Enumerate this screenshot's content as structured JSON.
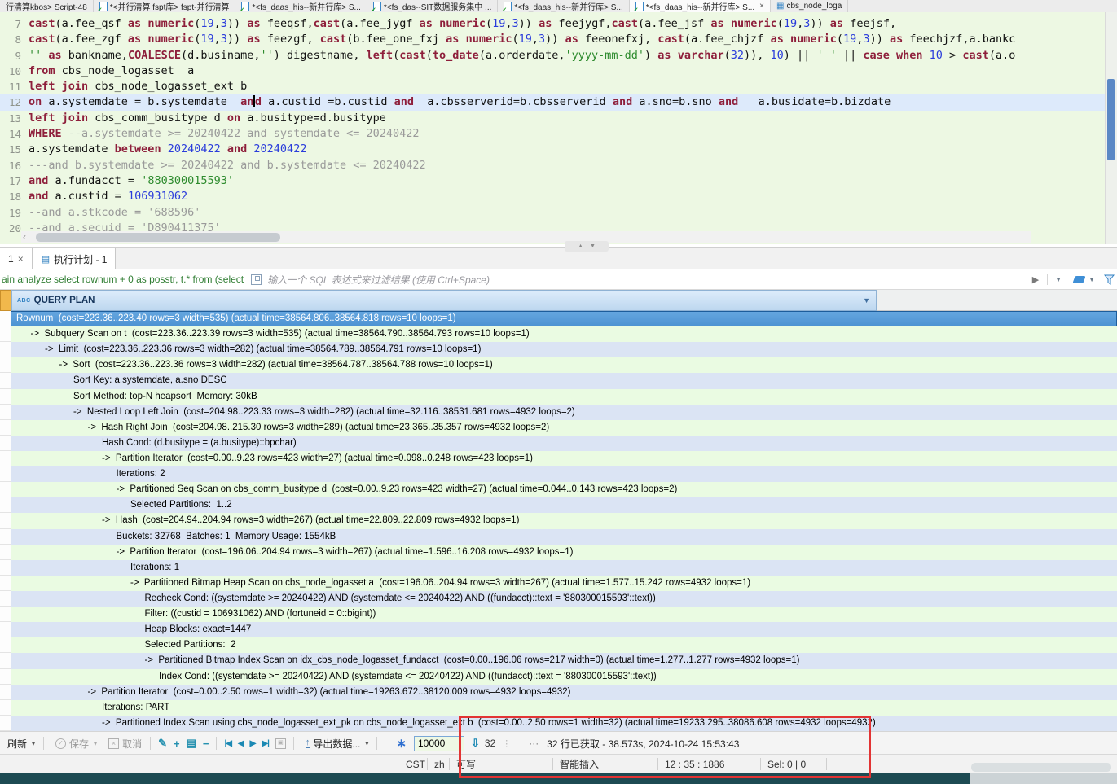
{
  "editor_tabs": [
    {
      "label": "行清算kbos> Script-48"
    },
    {
      "label": "*<并行清算 fspt库> fspt-并行清算",
      "icon": "sql"
    },
    {
      "label": "*<fs_daas_his--新并行库> S...",
      "icon": "sql"
    },
    {
      "label": "*<fs_das--SIT数据服务集中 ...",
      "icon": "sql"
    },
    {
      "label": "*<fs_daas_his--新并行库> S...",
      "icon": "sql"
    },
    {
      "label": "*<fs_daas_his--新并行库> S...",
      "icon": "sql",
      "active": true,
      "closable": true
    },
    {
      "label": "cbs_node_loga",
      "icon": "table"
    }
  ],
  "editor": {
    "lines": [
      {
        "no": "7",
        "segs": [
          [
            "k",
            "cast"
          ],
          [
            "t",
            "(a.fee_qsf "
          ],
          [
            "k",
            "as"
          ],
          [
            "t",
            " "
          ],
          [
            "k",
            "numeric"
          ],
          [
            "t",
            "("
          ],
          [
            "n",
            "19"
          ],
          [
            "t",
            ","
          ],
          [
            "n",
            "3"
          ],
          [
            "t",
            ")) "
          ],
          [
            "k",
            "as"
          ],
          [
            "t",
            " feeqsf,"
          ],
          [
            "k",
            "cast"
          ],
          [
            "t",
            "(a.fee_jygf "
          ],
          [
            "k",
            "as"
          ],
          [
            "t",
            " "
          ],
          [
            "k",
            "numeric"
          ],
          [
            "t",
            "("
          ],
          [
            "n",
            "19"
          ],
          [
            "t",
            ","
          ],
          [
            "n",
            "3"
          ],
          [
            "t",
            ")) "
          ],
          [
            "k",
            "as"
          ],
          [
            "t",
            " feejygf,"
          ],
          [
            "k",
            "cast"
          ],
          [
            "t",
            "(a.fee_jsf "
          ],
          [
            "k",
            "as"
          ],
          [
            "t",
            " "
          ],
          [
            "k",
            "numeric"
          ],
          [
            "t",
            "("
          ],
          [
            "n",
            "19"
          ],
          [
            "t",
            ","
          ],
          [
            "n",
            "3"
          ],
          [
            "t",
            ")) "
          ],
          [
            "k",
            "as"
          ],
          [
            "t",
            " feejsf,"
          ]
        ]
      },
      {
        "no": "8",
        "segs": [
          [
            "k",
            "cast"
          ],
          [
            "t",
            "(a.fee_zgf "
          ],
          [
            "k",
            "as"
          ],
          [
            "t",
            " "
          ],
          [
            "k",
            "numeric"
          ],
          [
            "t",
            "("
          ],
          [
            "n",
            "19"
          ],
          [
            "t",
            ","
          ],
          [
            "n",
            "3"
          ],
          [
            "t",
            ")) "
          ],
          [
            "k",
            "as"
          ],
          [
            "t",
            " feezgf, "
          ],
          [
            "k",
            "cast"
          ],
          [
            "t",
            "(b.fee_one_fxj "
          ],
          [
            "k",
            "as"
          ],
          [
            "t",
            " "
          ],
          [
            "k",
            "numeric"
          ],
          [
            "t",
            "("
          ],
          [
            "n",
            "19"
          ],
          [
            "t",
            ","
          ],
          [
            "n",
            "3"
          ],
          [
            "t",
            ")) "
          ],
          [
            "k",
            "as"
          ],
          [
            "t",
            " feeonefxj, "
          ],
          [
            "k",
            "cast"
          ],
          [
            "t",
            "(a.fee_chjzf "
          ],
          [
            "k",
            "as"
          ],
          [
            "t",
            " "
          ],
          [
            "k",
            "numeric"
          ],
          [
            "t",
            "("
          ],
          [
            "n",
            "19"
          ],
          [
            "t",
            ","
          ],
          [
            "n",
            "3"
          ],
          [
            "t",
            ")) "
          ],
          [
            "k",
            "as"
          ],
          [
            "t",
            " feechjzf,a.bankc"
          ]
        ]
      },
      {
        "no": "9",
        "segs": [
          [
            "s",
            "''"
          ],
          [
            "t",
            " "
          ],
          [
            "k",
            "as"
          ],
          [
            "t",
            " bankname,"
          ],
          [
            "k",
            "COALESCE"
          ],
          [
            "t",
            "(d.businame,"
          ],
          [
            "s",
            "''"
          ],
          [
            "t",
            ") digestname, "
          ],
          [
            "k",
            "left"
          ],
          [
            "t",
            "("
          ],
          [
            "k",
            "cast"
          ],
          [
            "t",
            "("
          ],
          [
            "k",
            "to_date"
          ],
          [
            "t",
            "(a.orderdate,"
          ],
          [
            "s",
            "'yyyy-mm-dd'"
          ],
          [
            "t",
            ") "
          ],
          [
            "k",
            "as"
          ],
          [
            "t",
            " "
          ],
          [
            "k",
            "varchar"
          ],
          [
            "t",
            "("
          ],
          [
            "n",
            "32"
          ],
          [
            "t",
            ")), "
          ],
          [
            "n",
            "10"
          ],
          [
            "t",
            ") || "
          ],
          [
            "s",
            "' '"
          ],
          [
            "t",
            " || "
          ],
          [
            "k",
            "case"
          ],
          [
            "t",
            " "
          ],
          [
            "k",
            "when"
          ],
          [
            "t",
            " "
          ],
          [
            "n",
            "10"
          ],
          [
            "t",
            " > "
          ],
          [
            "k",
            "cast"
          ],
          [
            "t",
            "(a.o"
          ]
        ]
      },
      {
        "no": "10",
        "segs": [
          [
            "k",
            "from"
          ],
          [
            "t",
            " cbs_node_logasset  a"
          ]
        ]
      },
      {
        "no": "11",
        "segs": [
          [
            "k",
            "left"
          ],
          [
            "t",
            " "
          ],
          [
            "k",
            "join"
          ],
          [
            "t",
            " cbs_node_logasset_ext b"
          ]
        ]
      },
      {
        "no": "12",
        "cur": true,
        "segs": [
          [
            "k",
            "on"
          ],
          [
            "t",
            " a.systemdate = b.systemdate  "
          ],
          [
            "k",
            "an"
          ],
          [
            "caret",
            ""
          ],
          [
            "k",
            "d"
          ],
          [
            "t",
            " a.custid =b.custid "
          ],
          [
            "k",
            "and"
          ],
          [
            "t",
            "  a.cbsserverid=b.cbsserverid "
          ],
          [
            "k",
            "and"
          ],
          [
            "t",
            " a.sno=b.sno "
          ],
          [
            "k",
            "and"
          ],
          [
            "t",
            "   a.busidate=b.bizdate"
          ]
        ]
      },
      {
        "no": "13",
        "segs": [
          [
            "k",
            "left"
          ],
          [
            "t",
            " "
          ],
          [
            "k",
            "join"
          ],
          [
            "t",
            " cbs_comm_busitype d "
          ],
          [
            "k",
            "on"
          ],
          [
            "t",
            " a.busitype=d.busitype"
          ]
        ]
      },
      {
        "no": "14",
        "segs": [
          [
            "k",
            "WHERE"
          ],
          [
            "t",
            " "
          ],
          [
            "c",
            "--a.systemdate >= 20240422 and systemdate <= 20240422"
          ]
        ]
      },
      {
        "no": "15",
        "segs": [
          [
            "t",
            "a.systemdate "
          ],
          [
            "k",
            "between"
          ],
          [
            "t",
            " "
          ],
          [
            "n",
            "20240422"
          ],
          [
            "t",
            " "
          ],
          [
            "k",
            "and"
          ],
          [
            "t",
            " "
          ],
          [
            "n",
            "20240422"
          ]
        ]
      },
      {
        "no": "16",
        "segs": [
          [
            "c",
            "---and b.systemdate >= 20240422 and b.systemdate <= 20240422"
          ]
        ]
      },
      {
        "no": "17",
        "segs": [
          [
            "k",
            "and"
          ],
          [
            "t",
            " a.fundacct = "
          ],
          [
            "s",
            "'880300015593'"
          ]
        ]
      },
      {
        "no": "18",
        "segs": [
          [
            "k",
            "and"
          ],
          [
            "t",
            " a.custid = "
          ],
          [
            "n",
            "106931062"
          ]
        ]
      },
      {
        "no": "19",
        "segs": [
          [
            "c",
            "--and a.stkcode = '688596'"
          ]
        ]
      },
      {
        "no": "20",
        "segs": [
          [
            "c",
            "--and a.secuid = 'D890411375'"
          ]
        ]
      }
    ]
  },
  "results": {
    "tabs": [
      {
        "label": "1"
      },
      {
        "label": "执行计划 - 1"
      }
    ],
    "filter": {
      "statement": "ain analyze select rownum + 0 as posstr, t.* from (select",
      "placeholder": "输入一个 SQL 表达式来过滤结果 (使用 Ctrl+Space)"
    }
  },
  "plan": {
    "header": {
      "type_badge": "ABC",
      "title": "QUERY PLAN"
    },
    "rows": [
      {
        "level": 0,
        "selected": true,
        "text": "Rownum  (cost=223.36..223.40 rows=3 width=535) (actual time=38564.806..38564.818 rows=10 loops=1)"
      },
      {
        "level": 1,
        "text": "->  Subquery Scan on t  (cost=223.36..223.39 rows=3 width=535) (actual time=38564.790..38564.793 rows=10 loops=1)"
      },
      {
        "level": 2,
        "text": "->  Limit  (cost=223.36..223.36 rows=3 width=282) (actual time=38564.789..38564.791 rows=10 loops=1)"
      },
      {
        "level": 3,
        "text": "->  Sort  (cost=223.36..223.36 rows=3 width=282) (actual time=38564.787..38564.788 rows=10 loops=1)"
      },
      {
        "level": 4,
        "text": "Sort Key: a.systemdate, a.sno DESC"
      },
      {
        "level": 4,
        "text": "Sort Method: top-N heapsort  Memory: 30kB"
      },
      {
        "level": 4,
        "text": "->  Nested Loop Left Join  (cost=204.98..223.33 rows=3 width=282) (actual time=32.116..38531.681 rows=4932 loops=2)"
      },
      {
        "level": 5,
        "text": "->  Hash Right Join  (cost=204.98..215.30 rows=3 width=289) (actual time=23.365..35.357 rows=4932 loops=2)"
      },
      {
        "level": 6,
        "text": "Hash Cond: (d.busitype = (a.busitype)::bpchar)"
      },
      {
        "level": 6,
        "text": "->  Partition Iterator  (cost=0.00..9.23 rows=423 width=27) (actual time=0.098..0.248 rows=423 loops=1)"
      },
      {
        "level": 7,
        "text": "Iterations: 2"
      },
      {
        "level": 7,
        "text": "->  Partitioned Seq Scan on cbs_comm_busitype d  (cost=0.00..9.23 rows=423 width=27) (actual time=0.044..0.143 rows=423 loops=2)"
      },
      {
        "level": 8,
        "text": "Selected Partitions:  1..2"
      },
      {
        "level": 6,
        "text": "->  Hash  (cost=204.94..204.94 rows=3 width=267) (actual time=22.809..22.809 rows=4932 loops=1)"
      },
      {
        "level": 7,
        "text": "Buckets: 32768  Batches: 1  Memory Usage: 1554kB"
      },
      {
        "level": 7,
        "text": "->  Partition Iterator  (cost=196.06..204.94 rows=3 width=267) (actual time=1.596..16.208 rows=4932 loops=1)"
      },
      {
        "level": 8,
        "text": "Iterations: 1"
      },
      {
        "level": 8,
        "text": "->  Partitioned Bitmap Heap Scan on cbs_node_logasset a  (cost=196.06..204.94 rows=3 width=267) (actual time=1.577..15.242 rows=4932 loops=1)"
      },
      {
        "level": 9,
        "text": "Recheck Cond: ((systemdate >= 20240422) AND (systemdate <= 20240422) AND ((fundacct)::text = '880300015593'::text))"
      },
      {
        "level": 9,
        "text": "Filter: ((custid = 106931062) AND (fortuneid = 0::bigint))"
      },
      {
        "level": 9,
        "text": "Heap Blocks: exact=1447"
      },
      {
        "level": 9,
        "text": "Selected Partitions:  2"
      },
      {
        "level": 9,
        "text": "->  Partitioned Bitmap Index Scan on idx_cbs_node_logasset_fundacct  (cost=0.00..196.06 rows=217 width=0) (actual time=1.277..1.277 rows=4932 loops=1)"
      },
      {
        "level": 10,
        "text": "Index Cond: ((systemdate >= 20240422) AND (systemdate <= 20240422) AND ((fundacct)::text = '880300015593'::text))"
      },
      {
        "level": 5,
        "text": "->  Partition Iterator  (cost=0.00..2.50 rows=1 width=32) (actual time=19263.672..38120.009 rows=4932 loops=4932)"
      },
      {
        "level": 6,
        "text": "Iterations: PART"
      },
      {
        "level": 6,
        "text": "->  Partitioned Index Scan using cbs_node_logasset_ext_pk on cbs_node_logasset_ext b  (cost=0.00..2.50 rows=1 width=32) (actual time=19233.295..38086.608 rows=4932 loops=4932)"
      }
    ]
  },
  "toolbar": {
    "refresh": "刷新",
    "save": "保存",
    "cancel": "取消",
    "export": "导出数据...",
    "fetch_size": "10000",
    "fetch_count": "32",
    "ellipsis": "···",
    "status": "32 行已获取 - 38.573s, 2024-10-24 15:53:43"
  },
  "statusbar": {
    "items": [
      "CST",
      "zh",
      "可写",
      "智能插入",
      "12 : 35 : 1886",
      "Sel: 0 | 0"
    ]
  },
  "colors": {
    "annotation_box": "#e23434",
    "selected_row": "#4f97d4",
    "row_stripe_blue": "#dbe4f4",
    "row_stripe_green": "#eafbe2",
    "keyword": "#8e1f3b",
    "string": "#2e8b2e",
    "number": "#2a3cdb",
    "comment": "#9a9a9a"
  }
}
